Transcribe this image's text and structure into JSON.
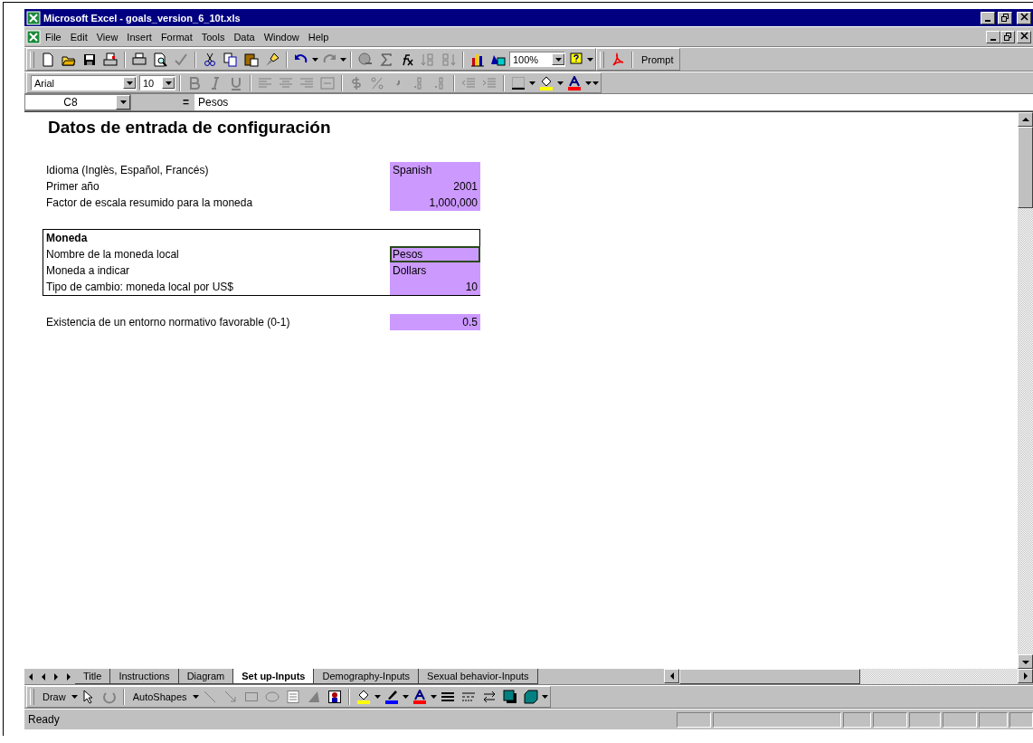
{
  "window": {
    "title": "Microsoft Excel - goals_version_6_10t.xls"
  },
  "menu": [
    "File",
    "Edit",
    "View",
    "Insert",
    "Format",
    "Tools",
    "Data",
    "Window",
    "Help"
  ],
  "standard_toolbar": {
    "zoom": "100%",
    "prompt": "Prompt"
  },
  "formatting_toolbar": {
    "font": "Arial",
    "size": "10"
  },
  "formula_bar": {
    "name_box": "C8",
    "equals": "=",
    "formula": "Pesos"
  },
  "sheet": {
    "title": "Datos de entrada de configuración",
    "blocks": [
      {
        "boxed": false,
        "rows": [
          {
            "label": "Idioma (Inglès, Español, Francés)",
            "value": "Spanish",
            "kind": "text",
            "selected": false
          },
          {
            "label": "Primer año",
            "value": "2001",
            "kind": "number",
            "selected": false
          },
          {
            "label": "Factor de escala resumido para la moneda",
            "value": "1,000,000",
            "kind": "number",
            "selected": false
          }
        ]
      },
      {
        "boxed": true,
        "heading": "Moneda",
        "rows": [
          {
            "label": "Nombre de la moneda local",
            "value": "Pesos",
            "kind": "text",
            "selected": true
          },
          {
            "label": "Moneda a indicar",
            "value": "Dollars",
            "kind": "text",
            "selected": false
          },
          {
            "label": "Tipo de cambio: moneda local por US$",
            "value": "10",
            "kind": "number",
            "selected": false
          }
        ]
      },
      {
        "boxed": false,
        "rows": [
          {
            "label": "Existencia de un entorno normativo favorable (0-1)",
            "value": "0.5",
            "kind": "number",
            "selected": false
          }
        ]
      }
    ]
  },
  "sheet_tabs": [
    {
      "label": "Title",
      "selected": false
    },
    {
      "label": "Instructions",
      "selected": false
    },
    {
      "label": "Diagram",
      "selected": false
    },
    {
      "label": "Set up-Inputs",
      "selected": true
    },
    {
      "label": "Demography-Inputs",
      "selected": false
    },
    {
      "label": "Sexual behavior-Inputs",
      "selected": false
    }
  ],
  "drawing_toolbar": {
    "draw": "Draw",
    "autoshapes": "AutoShapes"
  },
  "status_bar": {
    "text": "Ready"
  }
}
